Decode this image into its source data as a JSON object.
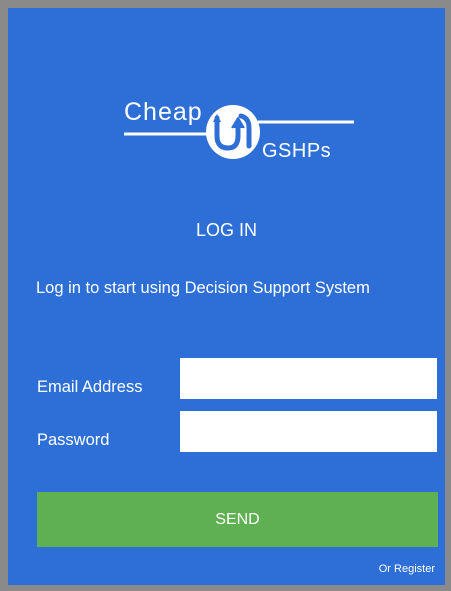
{
  "logo": {
    "word_left": "Cheap",
    "word_right": "GSHPs",
    "icon": "cheap-gshps-logo-mark"
  },
  "form": {
    "title": "LOG IN",
    "intro": "Log in to start using Decision Support System",
    "email_label": "Email Address",
    "email_value": "",
    "password_label": "Password",
    "password_value": "",
    "send_label": "SEND",
    "register_label": "Or Register"
  },
  "colors": {
    "page_background": "#8a8a8a",
    "panel_background": "#2d6fd6",
    "button_background": "#5fb052",
    "text": "#ffffff",
    "input_background": "#ffffff"
  }
}
